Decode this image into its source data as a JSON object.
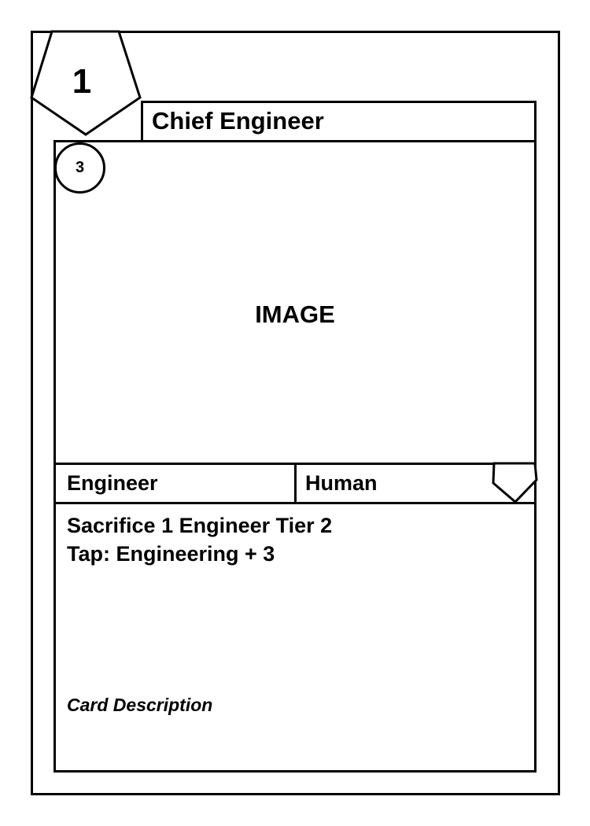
{
  "card": {
    "tier": "1",
    "cost": "3",
    "name": "Chief Engineer",
    "image_placeholder": "IMAGE",
    "type_left": "Engineer",
    "type_right": "Human",
    "ability_lines": [
      "Sacrifice 1 Engineer Tier 2",
      "Tap: Engineering + 3"
    ],
    "description": "Card Description"
  },
  "icons": {
    "tier_badge": "pentagon-icon",
    "faction_marker": "pentagon-icon",
    "cost_badge": "circle-icon"
  }
}
